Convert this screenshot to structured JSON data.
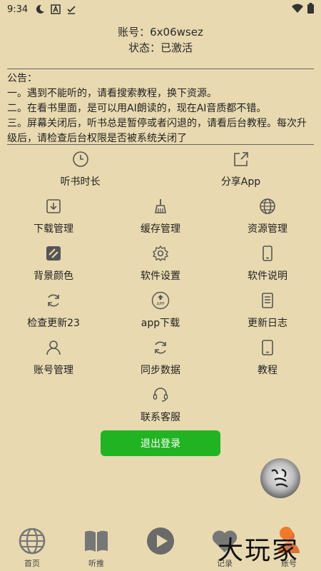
{
  "status_bar": {
    "time": "9:34",
    "icons": [
      "moon-icon",
      "a-icon",
      "check-icon"
    ],
    "right_icons": [
      "wifi-icon",
      "battery-icon"
    ]
  },
  "account": {
    "line1": "账号：6x06wsez",
    "line2": "状态：已激活"
  },
  "notice": {
    "title": "公告：",
    "lines": [
      "一。遇到不能听的，请看搜索教程，换下资源。",
      "二。在看书里面，是可以用AI朗读的，现在AI音质都不错。",
      "三。屏幕关闭后，听书总是暂停或者闪退的，请看后台教程。每次升级后，请检查后台权限是否被系统关闭了"
    ]
  },
  "grid": {
    "row1": [
      "听书时长",
      "分享App"
    ],
    "row2": [
      "下载管理",
      "缓存管理",
      "资源管理"
    ],
    "row3": [
      "背景颜色",
      "软件设置",
      "软件说明"
    ],
    "row4": [
      "检查更新23",
      "app下载",
      "更新日志"
    ],
    "row5": [
      "账号管理",
      "同步数据",
      "教程"
    ],
    "row6": [
      "联系客服"
    ]
  },
  "logout_label": "退出登录",
  "tabs": [
    "首页",
    "听推",
    "",
    "记录",
    "账号"
  ],
  "watermark": "大玩家",
  "colors": {
    "background": "#e8d9b0",
    "accent_green": "#22b322"
  }
}
